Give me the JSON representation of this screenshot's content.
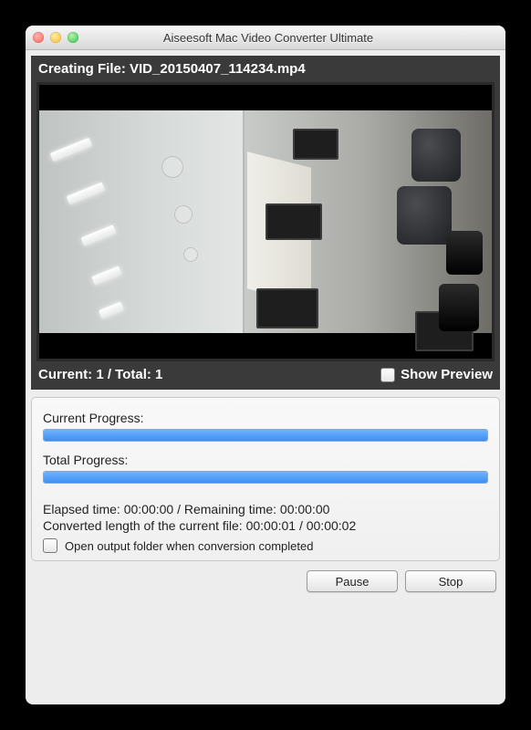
{
  "window": {
    "title": "Aiseesoft Mac Video Converter Ultimate"
  },
  "creating": {
    "label": "Creating File: VID_20150407_114234.mp4"
  },
  "preview": {
    "current_total": "Current: 1 / Total: 1",
    "show_preview_label": "Show Preview"
  },
  "progress": {
    "current_label": "Current Progress:",
    "total_label": "Total Progress:",
    "elapsed_remaining": "Elapsed time: 00:00:00 / Remaining time: 00:00:00",
    "converted_length": "Converted length of the current file: 00:00:01 / 00:00:02",
    "open_output_label": "Open output folder when conversion completed"
  },
  "buttons": {
    "pause": "Pause",
    "stop": "Stop"
  }
}
